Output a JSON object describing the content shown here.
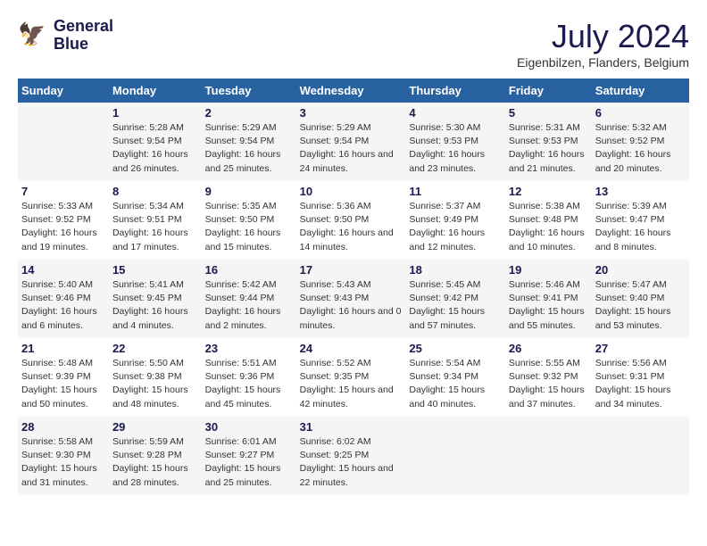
{
  "header": {
    "logo_line1": "General",
    "logo_line2": "Blue",
    "month_year": "July 2024",
    "location": "Eigenbilzen, Flanders, Belgium"
  },
  "weekdays": [
    "Sunday",
    "Monday",
    "Tuesday",
    "Wednesday",
    "Thursday",
    "Friday",
    "Saturday"
  ],
  "weeks": [
    [
      {
        "day": "",
        "info": ""
      },
      {
        "day": "1",
        "info": "Sunrise: 5:28 AM\nSunset: 9:54 PM\nDaylight: 16 hours\nand 26 minutes."
      },
      {
        "day": "2",
        "info": "Sunrise: 5:29 AM\nSunset: 9:54 PM\nDaylight: 16 hours\nand 25 minutes."
      },
      {
        "day": "3",
        "info": "Sunrise: 5:29 AM\nSunset: 9:54 PM\nDaylight: 16 hours\nand 24 minutes."
      },
      {
        "day": "4",
        "info": "Sunrise: 5:30 AM\nSunset: 9:53 PM\nDaylight: 16 hours\nand 23 minutes."
      },
      {
        "day": "5",
        "info": "Sunrise: 5:31 AM\nSunset: 9:53 PM\nDaylight: 16 hours\nand 21 minutes."
      },
      {
        "day": "6",
        "info": "Sunrise: 5:32 AM\nSunset: 9:52 PM\nDaylight: 16 hours\nand 20 minutes."
      }
    ],
    [
      {
        "day": "7",
        "info": "Sunrise: 5:33 AM\nSunset: 9:52 PM\nDaylight: 16 hours\nand 19 minutes."
      },
      {
        "day": "8",
        "info": "Sunrise: 5:34 AM\nSunset: 9:51 PM\nDaylight: 16 hours\nand 17 minutes."
      },
      {
        "day": "9",
        "info": "Sunrise: 5:35 AM\nSunset: 9:50 PM\nDaylight: 16 hours\nand 15 minutes."
      },
      {
        "day": "10",
        "info": "Sunrise: 5:36 AM\nSunset: 9:50 PM\nDaylight: 16 hours\nand 14 minutes."
      },
      {
        "day": "11",
        "info": "Sunrise: 5:37 AM\nSunset: 9:49 PM\nDaylight: 16 hours\nand 12 minutes."
      },
      {
        "day": "12",
        "info": "Sunrise: 5:38 AM\nSunset: 9:48 PM\nDaylight: 16 hours\nand 10 minutes."
      },
      {
        "day": "13",
        "info": "Sunrise: 5:39 AM\nSunset: 9:47 PM\nDaylight: 16 hours\nand 8 minutes."
      }
    ],
    [
      {
        "day": "14",
        "info": "Sunrise: 5:40 AM\nSunset: 9:46 PM\nDaylight: 16 hours\nand 6 minutes."
      },
      {
        "day": "15",
        "info": "Sunrise: 5:41 AM\nSunset: 9:45 PM\nDaylight: 16 hours\nand 4 minutes."
      },
      {
        "day": "16",
        "info": "Sunrise: 5:42 AM\nSunset: 9:44 PM\nDaylight: 16 hours\nand 2 minutes."
      },
      {
        "day": "17",
        "info": "Sunrise: 5:43 AM\nSunset: 9:43 PM\nDaylight: 16 hours\nand 0 minutes."
      },
      {
        "day": "18",
        "info": "Sunrise: 5:45 AM\nSunset: 9:42 PM\nDaylight: 15 hours\nand 57 minutes."
      },
      {
        "day": "19",
        "info": "Sunrise: 5:46 AM\nSunset: 9:41 PM\nDaylight: 15 hours\nand 55 minutes."
      },
      {
        "day": "20",
        "info": "Sunrise: 5:47 AM\nSunset: 9:40 PM\nDaylight: 15 hours\nand 53 minutes."
      }
    ],
    [
      {
        "day": "21",
        "info": "Sunrise: 5:48 AM\nSunset: 9:39 PM\nDaylight: 15 hours\nand 50 minutes."
      },
      {
        "day": "22",
        "info": "Sunrise: 5:50 AM\nSunset: 9:38 PM\nDaylight: 15 hours\nand 48 minutes."
      },
      {
        "day": "23",
        "info": "Sunrise: 5:51 AM\nSunset: 9:36 PM\nDaylight: 15 hours\nand 45 minutes."
      },
      {
        "day": "24",
        "info": "Sunrise: 5:52 AM\nSunset: 9:35 PM\nDaylight: 15 hours\nand 42 minutes."
      },
      {
        "day": "25",
        "info": "Sunrise: 5:54 AM\nSunset: 9:34 PM\nDaylight: 15 hours\nand 40 minutes."
      },
      {
        "day": "26",
        "info": "Sunrise: 5:55 AM\nSunset: 9:32 PM\nDaylight: 15 hours\nand 37 minutes."
      },
      {
        "day": "27",
        "info": "Sunrise: 5:56 AM\nSunset: 9:31 PM\nDaylight: 15 hours\nand 34 minutes."
      }
    ],
    [
      {
        "day": "28",
        "info": "Sunrise: 5:58 AM\nSunset: 9:30 PM\nDaylight: 15 hours\nand 31 minutes."
      },
      {
        "day": "29",
        "info": "Sunrise: 5:59 AM\nSunset: 9:28 PM\nDaylight: 15 hours\nand 28 minutes."
      },
      {
        "day": "30",
        "info": "Sunrise: 6:01 AM\nSunset: 9:27 PM\nDaylight: 15 hours\nand 25 minutes."
      },
      {
        "day": "31",
        "info": "Sunrise: 6:02 AM\nSunset: 9:25 PM\nDaylight: 15 hours\nand 22 minutes."
      },
      {
        "day": "",
        "info": ""
      },
      {
        "day": "",
        "info": ""
      },
      {
        "day": "",
        "info": ""
      }
    ]
  ]
}
